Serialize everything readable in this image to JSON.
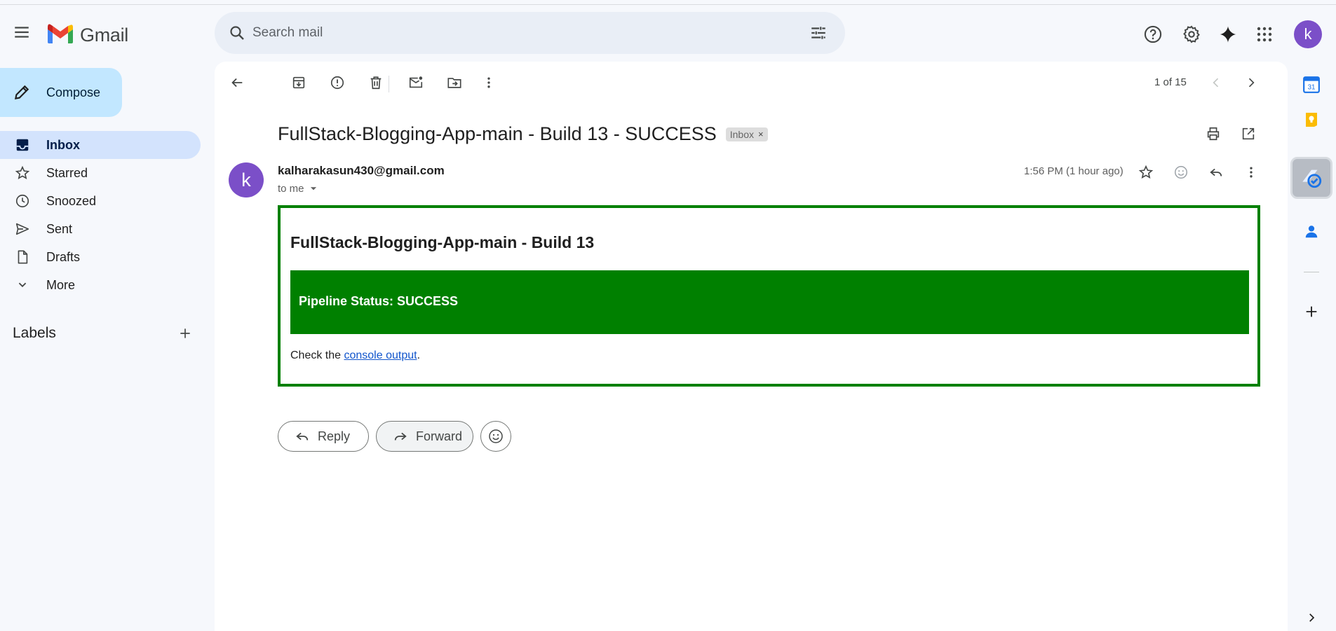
{
  "app": {
    "name": "Gmail"
  },
  "search": {
    "placeholder": "Search mail"
  },
  "user": {
    "avatar_letter": "k",
    "avatar_color": "#7b4fc8"
  },
  "sidebar": {
    "compose_label": "Compose",
    "items": [
      {
        "label": "Inbox",
        "icon": "inbox-icon",
        "active": true
      },
      {
        "label": "Starred",
        "icon": "star-icon"
      },
      {
        "label": "Snoozed",
        "icon": "clock-icon"
      },
      {
        "label": "Sent",
        "icon": "send-icon"
      },
      {
        "label": "Drafts",
        "icon": "draft-icon"
      },
      {
        "label": "More",
        "icon": "chevron-down-icon"
      }
    ],
    "labels_title": "Labels"
  },
  "toolbar": {
    "pager": "1 of 15"
  },
  "message": {
    "subject": "FullStack-Blogging-App-main - Build 13 - SUCCESS",
    "label_chip": "Inbox",
    "chip_close": "×",
    "sender_initial": "k",
    "sender_email": "kalharakasun430@gmail.com",
    "recipient": "to me",
    "timestamp": "1:56 PM (1 hour ago)",
    "body": {
      "heading": "FullStack-Blogging-App-main - Build 13",
      "status": "Pipeline Status: SUCCESS",
      "check_prefix": "Check the ",
      "link_text": "console output",
      "check_suffix": "."
    },
    "status_color": "#008000"
  },
  "actions": {
    "reply": "Reply",
    "forward": "Forward"
  },
  "side_panel": {
    "calendar_day": "31",
    "apps": [
      "calendar-icon",
      "keep-icon",
      "tasks-icon",
      "contacts-icon",
      "add-icon"
    ]
  }
}
